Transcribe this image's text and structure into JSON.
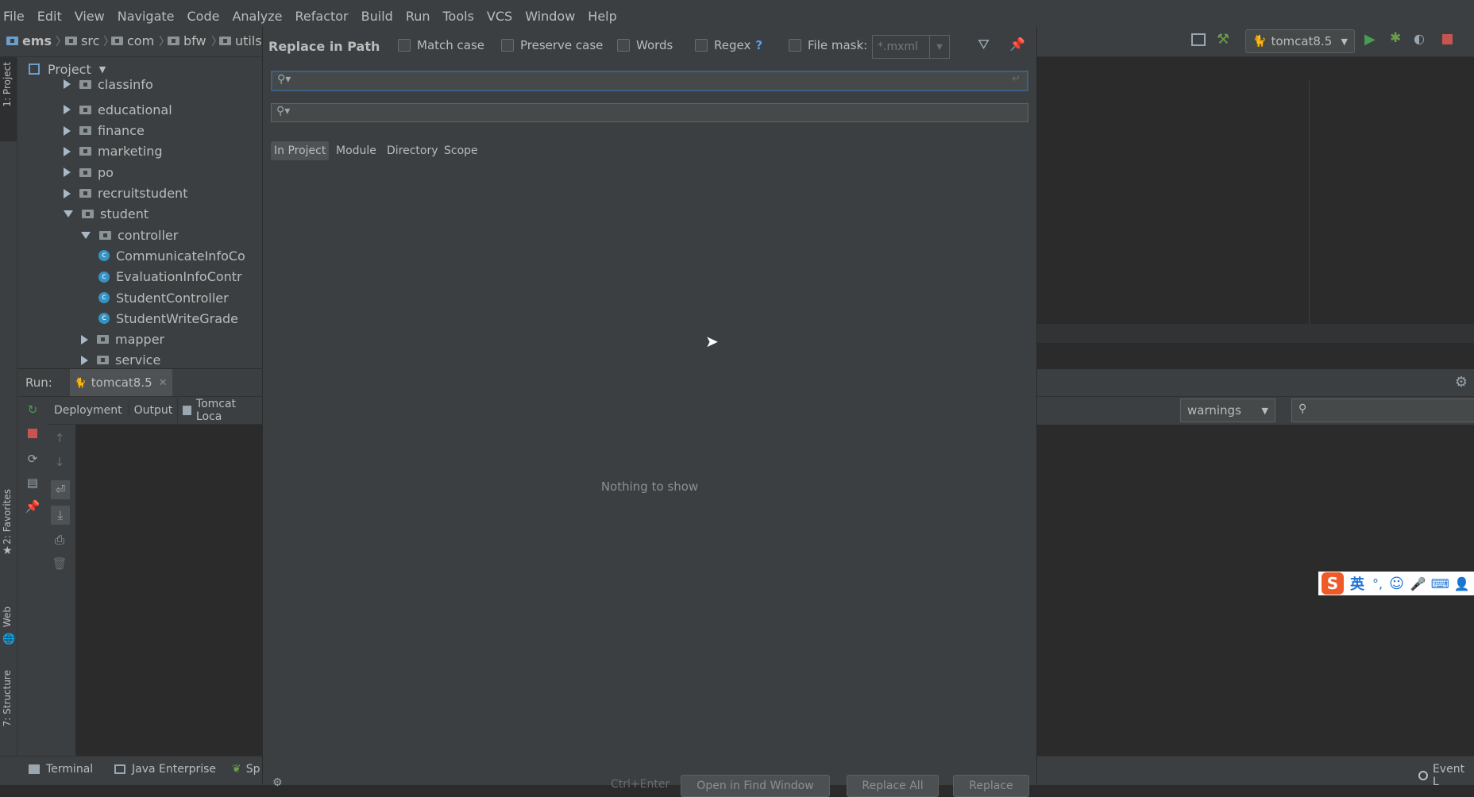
{
  "menubar": {
    "items": [
      "File",
      "Edit",
      "View",
      "Navigate",
      "Code",
      "Analyze",
      "Refactor",
      "Build",
      "Run",
      "Tools",
      "VCS",
      "Window",
      "Help"
    ]
  },
  "navbar": {
    "breadcrumbs": [
      "ems",
      "src",
      "com",
      "bfw",
      "utils"
    ],
    "run_config": "tomcat8.5"
  },
  "left_strip": {
    "tabs": [
      "1: Project",
      "2: Favorites",
      "Web",
      "7: Structure"
    ]
  },
  "project": {
    "header": "Project",
    "tree": [
      {
        "label": "classinfo",
        "kind": "folder",
        "expanded": false,
        "depth": 1
      },
      {
        "label": "educational",
        "kind": "folder",
        "expanded": false,
        "depth": 1
      },
      {
        "label": "finance",
        "kind": "folder",
        "expanded": false,
        "depth": 1
      },
      {
        "label": "marketing",
        "kind": "folder",
        "expanded": false,
        "depth": 1
      },
      {
        "label": "po",
        "kind": "folder",
        "expanded": false,
        "depth": 1
      },
      {
        "label": "recruitstudent",
        "kind": "folder",
        "expanded": false,
        "depth": 1
      },
      {
        "label": "student",
        "kind": "folder",
        "expanded": true,
        "depth": 1
      },
      {
        "label": "controller",
        "kind": "folder",
        "expanded": true,
        "depth": 2
      },
      {
        "label": "CommunicateInfoCo",
        "kind": "class",
        "depth": 3
      },
      {
        "label": "EvaluationInfoContr",
        "kind": "class",
        "depth": 3
      },
      {
        "label": "StudentController",
        "kind": "class",
        "depth": 3
      },
      {
        "label": "StudentWriteGrade",
        "kind": "class",
        "depth": 3
      },
      {
        "label": "mapper",
        "kind": "folder",
        "expanded": false,
        "depth": 2
      },
      {
        "label": "service",
        "kind": "folder",
        "expanded": false,
        "depth": 2
      }
    ]
  },
  "run": {
    "label": "Run:",
    "tab": "tomcat8.5",
    "subtabs": [
      "Deployment",
      "Output",
      "Tomcat Loca"
    ],
    "filter_value": "warnings"
  },
  "dialog": {
    "title": "Replace in Path",
    "options": {
      "match_case": "Match case",
      "preserve_case": "Preserve case",
      "words": "Words",
      "regex": "Regex",
      "regex_help": "?",
      "file_mask": "File mask:",
      "file_mask_value": "*.mxml"
    },
    "search_value": "",
    "replace_value": "",
    "scopes": [
      "In Project",
      "Module",
      "Directory",
      "Scope"
    ],
    "active_scope": "In Project",
    "empty_text": "Nothing to show",
    "shortcut": "Ctrl+Enter",
    "buttons": {
      "open_in_find": "Open in Find Window",
      "replace_all": "Replace All",
      "replace": "Replace"
    }
  },
  "bottom_bar": {
    "tabs": [
      "Terminal",
      "Java Enterprise",
      "Sp"
    ],
    "event_log": "Event L"
  },
  "ime": {
    "lang": "英"
  },
  "colors": {
    "bg": "#2b2b2b",
    "panel": "#3c3f41",
    "accent": "#3592c4",
    "run_green": "#499c54",
    "stop_red": "#c75450"
  }
}
